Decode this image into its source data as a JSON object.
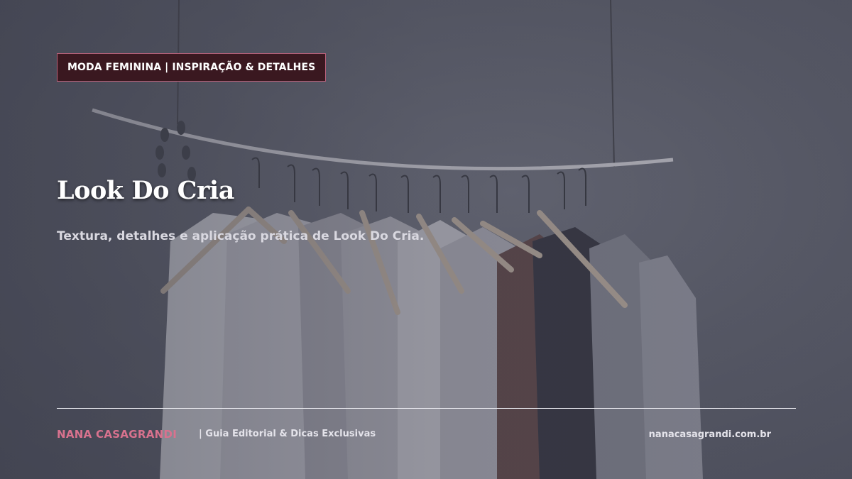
{
  "tag": {
    "label": "MODA FEMININA | INSPIRAÇÃO & DETALHES"
  },
  "hero": {
    "title": "Look Do Cria",
    "subtitle": "Textura, detalhes e aplicação prática de Look Do Cria."
  },
  "footer": {
    "brand": "NANA CASAGRANDI",
    "tagline": "|  Guia Editorial & Dicas Exclusivas",
    "site": "nanacasagrandi.com.br"
  },
  "colors": {
    "accent": "#d8728e",
    "tag_bg": "#3a1820",
    "tag_border": "#b9617a"
  }
}
